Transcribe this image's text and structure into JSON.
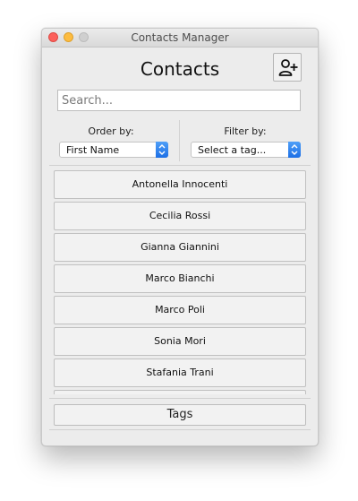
{
  "window": {
    "title": "Contacts Manager"
  },
  "header": {
    "title": "Contacts",
    "add_contact_icon": "add-user-icon"
  },
  "search": {
    "placeholder": "Search...",
    "value": ""
  },
  "order": {
    "label": "Order by:",
    "selected": "First Name"
  },
  "filter": {
    "label": "Filter by:",
    "selected": "Select a tag..."
  },
  "contacts": [
    "Antonella Innocenti",
    "Cecilia Rossi",
    "Gianna Giannini",
    "Marco Bianchi",
    "Marco Poli",
    "Sonia Mori",
    "Stafania Trani",
    ""
  ],
  "footer": {
    "tags_label": "Tags"
  },
  "colors": {
    "close": "#fc605b",
    "minimize": "#fdbc40",
    "zoom": "#cfcfcf",
    "select_accent": "#1c6fe6"
  }
}
